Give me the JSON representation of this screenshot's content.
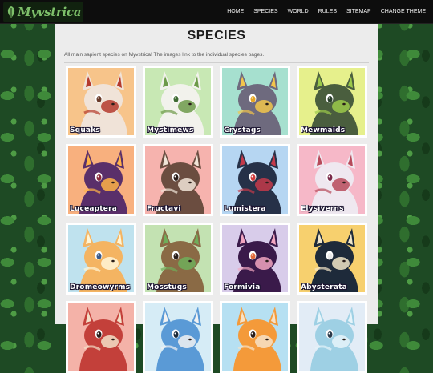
{
  "site": {
    "logo_text": "Myvstrica"
  },
  "nav": {
    "items": [
      {
        "label": "HOME"
      },
      {
        "label": "SPECIES"
      },
      {
        "label": "WORLD"
      },
      {
        "label": "RULES"
      },
      {
        "label": "SITEMAP"
      },
      {
        "label": "CHANGE THEME"
      }
    ]
  },
  "page": {
    "title": "SPECIES",
    "intro": "All main sapient species on Myvstrica! The images link to the individual species pages."
  },
  "species": [
    {
      "name": "Squaks",
      "bg": "#f7c48a",
      "fur": "#f0e3d8",
      "accent": "#b43a2e",
      "eye": "#6a3b2a"
    },
    {
      "name": "Mystimews",
      "bg": "#c8e8b4",
      "fur": "#f2f2ec",
      "accent": "#6d9a4a",
      "eye": "#3e6b32"
    },
    {
      "name": "Crystags",
      "bg": "#a6e0cf",
      "fur": "#6e6a7e",
      "accent": "#f2c54b",
      "eye": "#e6a522"
    },
    {
      "name": "Mewmaids",
      "bg": "#e6f08c",
      "fur": "#4a5e3e",
      "accent": "#9bc94a",
      "eye": "#2a3e2a"
    },
    {
      "name": "Luceaptera",
      "bg": "#f8b07e",
      "fur": "#5a2f6a",
      "accent": "#ffb347",
      "eye": "#8a2a3a"
    },
    {
      "name": "Fructavi",
      "bg": "#f6b3ae",
      "fur": "#6b4d40",
      "accent": "#f1e5d8",
      "eye": "#2a1e1a"
    },
    {
      "name": "Lumistera",
      "bg": "#b6d6f2",
      "fur": "#263148",
      "accent": "#c43a4a",
      "eye": "#d23b3b"
    },
    {
      "name": "Elysiverns",
      "bg": "#f6b8c8",
      "fur": "#efe8f0",
      "accent": "#b74a5a",
      "eye": "#7a2a4a"
    },
    {
      "name": "Dromeowyrms",
      "bg": "#bfe2ee",
      "fur": "#f4b462",
      "accent": "#fff6d8",
      "eye": "#3a5a8a"
    },
    {
      "name": "Mosstugs",
      "bg": "#c3e2b2",
      "fur": "#8a6a45",
      "accent": "#6fae5a",
      "eye": "#2a1e1a"
    },
    {
      "name": "Formivia",
      "bg": "#d8ccea",
      "fur": "#3a1a4a",
      "accent": "#f2a6c0",
      "eye": "#e26a3a"
    },
    {
      "name": "Abysterata",
      "bg": "#f7d06e",
      "fur": "#1e2a3a",
      "accent": "#f2e6c8",
      "eye": "#e8e8e8"
    },
    {
      "name": "",
      "bg": "#f4b2a8",
      "fur": "#c3403a",
      "accent": "#f3e0c8",
      "eye": "#2a1e1a"
    },
    {
      "name": "",
      "bg": "#d6ecf6",
      "fur": "#5a9ad6",
      "accent": "#f2f2f2",
      "eye": "#1a2a3a"
    },
    {
      "name": "",
      "bg": "#b6e0f2",
      "fur": "#f49a3a",
      "accent": "#f6e2c8",
      "eye": "#2a1e1a"
    },
    {
      "name": "",
      "bg": "#e2ecf6",
      "fur": "#9ed0e4",
      "accent": "#e6f4fa",
      "eye": "#2a3a4a"
    }
  ]
}
